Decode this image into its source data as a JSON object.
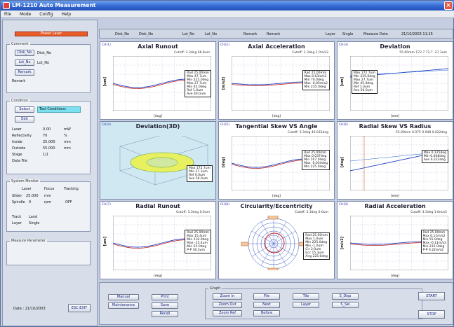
{
  "window": {
    "title": "LM-1210 Auto Measurement"
  },
  "menu": [
    "File",
    "Mode",
    "Config",
    "Help"
  ],
  "left": {
    "status_bar": "Power Laser",
    "comment_group": "Comment",
    "comment_rows": [
      {
        "button": "Disk_No",
        "value": "Disk_No"
      },
      {
        "button": "Lot_No",
        "value": "Lot_No"
      },
      {
        "button": "Remark",
        "value": ""
      }
    ],
    "remark_text": "Remark",
    "condition_group": "Condition",
    "select_button": "Select",
    "select_value": "Test Conditions",
    "edit_button": "Edit",
    "condition_rows": [
      {
        "label": "Laser",
        "value": "0.00",
        "unit": "mW"
      },
      {
        "label": "Reflectivity",
        "value": "70",
        "unit": "%"
      },
      {
        "label": "Inside",
        "value": "25.000",
        "unit": "mm"
      },
      {
        "label": "Outside",
        "value": "55.000",
        "unit": "mm"
      },
      {
        "label": "Stage",
        "value": "1/1",
        "unit": ""
      },
      {
        "label": "Data File",
        "value": "",
        "unit": ""
      }
    ],
    "system_group": "System Monitor",
    "system_headers": [
      "Laser",
      "Focus",
      "Tracking"
    ],
    "system_rows": [
      {
        "label": "Slider",
        "a": "25.000",
        "b": "mm",
        "c": ""
      },
      {
        "label": "Spindle",
        "a": "0",
        "b": "rpm",
        "c": "OFF"
      }
    ],
    "track_label": "Track",
    "track_value": "Land",
    "layer_label": "Layer",
    "layer_value": "Single",
    "measure_group": "Measure Parameter",
    "date_text": "Date : 21/10/2003",
    "esc_exit": "ESC:EXIT"
  },
  "header": [
    {
      "label": "Disk_No",
      "value": "Disk_No"
    },
    {
      "label": "Lot_No",
      "value": "Lot_No"
    },
    {
      "label": "Remark",
      "value": "Remark"
    },
    {
      "label": "Layer",
      "value": "Single"
    },
    {
      "label": "Measure Date",
      "value": "21/10/2003 11:25"
    }
  ],
  "panels": [
    {
      "num": "CH(1)",
      "title": "Axial Runout",
      "sub": "Cutoff: 3.3deg 66.8um",
      "ylabel": "[um]",
      "xlabel": "[deg]",
      "legend": [
        "Rad 25.00mm",
        "Max 47.7um",
        "Min 225.0deg",
        "Max 27.7um",
        "Min 45.0deg",
        "Ref 1.0um",
        "Ave 40.0um"
      ]
    },
    {
      "num": "CH(2)",
      "title": "Axial Acceleration",
      "sub": "Cutoff: 3.3deg 1.0m/s2",
      "ylabel": "[m/s2]",
      "xlabel": "[deg]",
      "legend": [
        "Rad 25.00mm",
        "Max 0.03m/s2",
        "Min 70.0deg",
        "Max -0.05m/s2",
        "Min 235.0deg"
      ]
    },
    {
      "num": "CH(3)",
      "title": "Deviation",
      "sub": "55.00mm 172.7 72.7 -27.3um",
      "ylabel": "[um]",
      "xlabel": "[mm]",
      "legend": [
        "Max 172.7um",
        "Min 225.0deg",
        "Max 27.7um",
        "Min 45.0deg",
        "Ref 1.0um",
        "Ave 50.0um"
      ]
    },
    {
      "num": "CH(4)",
      "title": "Deviation(3D)",
      "sub": "",
      "ylabel": "",
      "xlabel": "",
      "legend": [
        "Max 172.7um",
        "Min 27.3um",
        "Ref 0.0um",
        "Ave 50.0um"
      ]
    },
    {
      "num": "CH(5)",
      "title": "Tangential Skew VS Angle",
      "sub": "Cutoff: 3.3deg 40.032deg",
      "ylabel": "[deg]",
      "xlabel": "[deg]",
      "legend": [
        "Rad 25.00mm",
        "Max 0.037deg",
        "Min 107.0deg",
        "Max -0.034deg",
        "Min 225.0deg"
      ]
    },
    {
      "num": "CH(6)",
      "title": "Radial Skew VS Radius",
      "sub": "55.00mm 0.075 0.048 0.022deg",
      "ylabel": "[deg]",
      "xlabel": "[mm]",
      "legend": [
        "Max 0.125deg",
        "Min 0.048deg",
        "Ave 0.222deg"
      ]
    },
    {
      "num": "CH(7)",
      "title": "Radial Runout",
      "sub": "Cutoff: 3.3deg 0.0um",
      "ylabel": "[um]",
      "xlabel": "[deg]",
      "legend": [
        "Rad 25.00mm",
        "Max 15.4um",
        "Min 210.0deg",
        "Max -15.4um",
        "Min 55.0deg",
        "P-P 30.3um"
      ]
    },
    {
      "num": "CH(8)",
      "title": "Circularity/Eccentricity",
      "sub": "Cutoff: 3.3deg 0.0um",
      "ylabel": "",
      "xlabel": "",
      "legend": [
        "Rad 25.00mm",
        "Max 1.0um",
        "Min 225.0deg",
        "Min -1.0um",
        "Cir 2.0um",
        "Ecc 15.3um",
        "Ang 225.0deg"
      ]
    },
    {
      "num": "CH(9)",
      "title": "Radial Acceleration",
      "sub": "Cutoff: 3.3deg 1.0m/s2",
      "ylabel": "[m/s2]",
      "xlabel": "[deg]",
      "legend": [
        "Rad 25.00mm",
        "Max 0.11m/s2",
        "Min 55.0deg",
        "Max -0.11m/s2",
        "Min 235.0deg",
        "P-P 0.22m/s2"
      ]
    }
  ],
  "bottom": {
    "left_buttons": [
      "Manual",
      "Maintenance",
      "Print",
      "Save",
      "Recall"
    ],
    "graph_group": "Graph",
    "graph_buttons": [
      "Zoom In",
      "Zoom Out",
      "Zoom Ref",
      "File",
      "Next",
      "Before",
      "Tile",
      "Layer",
      "S_Disp",
      "S_Sel"
    ],
    "start": "START",
    "stop": "STOP"
  }
}
